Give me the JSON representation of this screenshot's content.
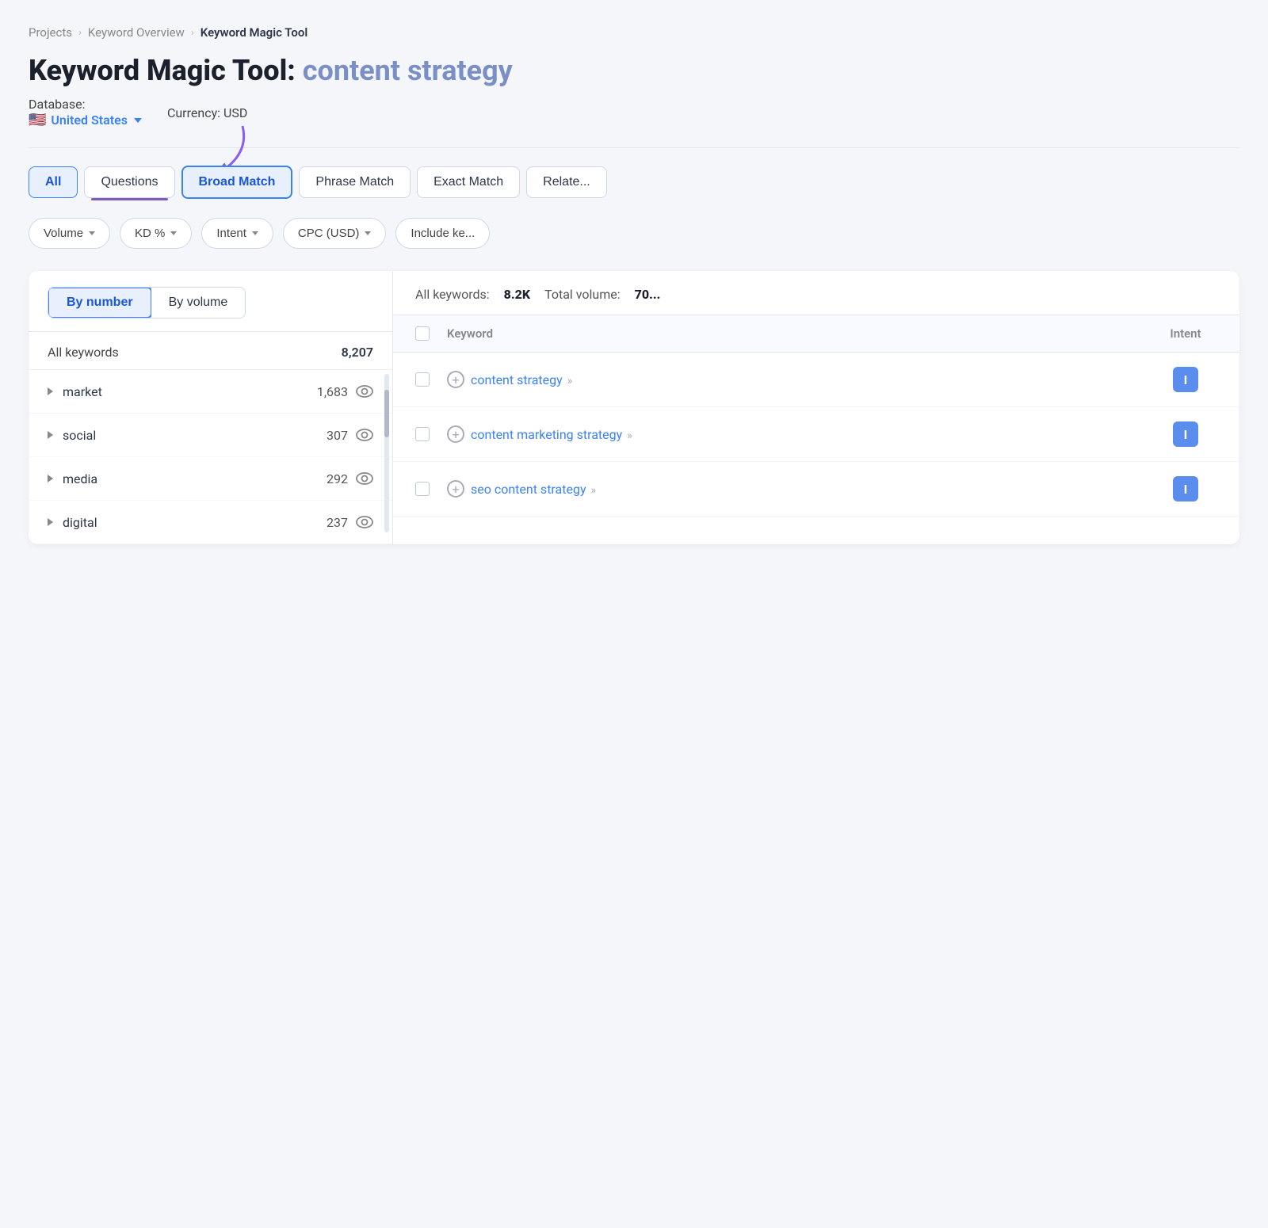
{
  "breadcrumb": {
    "items": [
      "Projects",
      "Keyword Overview",
      "Keyword Magic Tool"
    ]
  },
  "page": {
    "title": "Keyword Magic Tool:",
    "query": "content strategy"
  },
  "database": {
    "label": "Database:",
    "flag": "🇺🇸",
    "country": "United States",
    "currency_label": "Currency:",
    "currency": "USD"
  },
  "tabs": {
    "all_label": "All",
    "questions_label": "Questions",
    "broad_match_label": "Broad Match",
    "phrase_match_label": "Phrase Match",
    "exact_match_label": "Exact Match",
    "related_label": "Relate..."
  },
  "filters": {
    "volume_label": "Volume",
    "kd_label": "KD %",
    "intent_label": "Intent",
    "cpc_label": "CPC (USD)",
    "include_label": "Include ke..."
  },
  "left_panel": {
    "toggle_by_number": "By number",
    "toggle_by_volume": "By volume",
    "all_keywords_label": "All keywords",
    "all_keywords_count": "8,207",
    "groups": [
      {
        "name": "market",
        "count": "1,683"
      },
      {
        "name": "social",
        "count": "307"
      },
      {
        "name": "media",
        "count": "292"
      },
      {
        "name": "digital",
        "count": "237"
      }
    ]
  },
  "right_panel": {
    "all_keywords_label": "All keywords:",
    "all_keywords_count": "8.2K",
    "total_volume_label": "Total volume:",
    "total_volume_value": "70...",
    "columns": {
      "keyword": "Keyword",
      "intent": "Intent"
    },
    "rows": [
      {
        "keyword": "content strategy",
        "arrows": "»",
        "intent": "I",
        "has_add": true
      },
      {
        "keyword": "content marketing strategy",
        "arrows": "»",
        "intent": "I",
        "has_add": true
      },
      {
        "keyword": "seo content strategy",
        "arrows": "»",
        "intent": "I",
        "has_add": true
      }
    ]
  }
}
